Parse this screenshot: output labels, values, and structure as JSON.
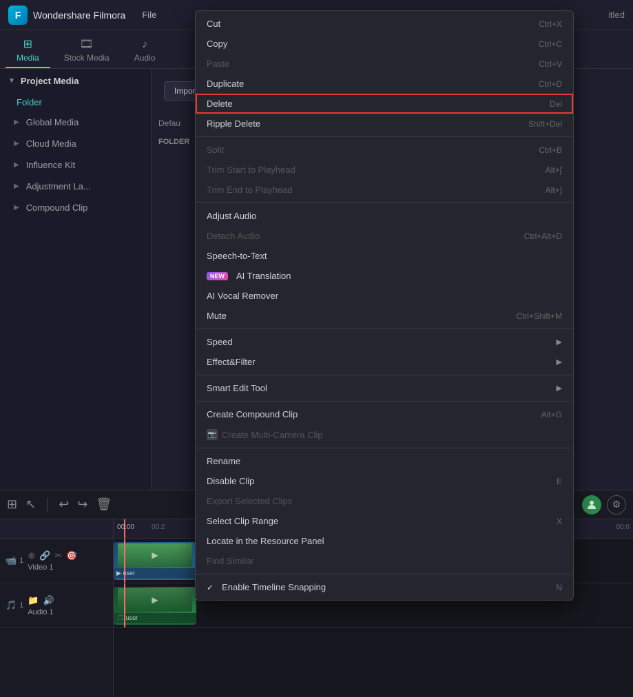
{
  "app": {
    "name": "Wondershare Filmora",
    "logo": "F",
    "title_suffix": "itled"
  },
  "topbar": {
    "menu_items": [
      "File"
    ]
  },
  "media_tabs": [
    {
      "id": "media",
      "label": "Media",
      "icon": "⊞",
      "active": true
    },
    {
      "id": "stock_media",
      "label": "Stock Media",
      "icon": "🎞"
    },
    {
      "id": "audio",
      "label": "Audio",
      "icon": "♪"
    }
  ],
  "sidebar": {
    "header": "Project Media",
    "folder_name": "Folder",
    "items": [
      {
        "label": "Global Media",
        "icon": "▶"
      },
      {
        "label": "Cloud Media",
        "icon": "▶"
      },
      {
        "label": "Influence Kit",
        "icon": "▶"
      },
      {
        "label": "Adjustment La...",
        "icon": "▶"
      },
      {
        "label": "Compound Clip",
        "icon": "▶"
      }
    ],
    "bottom_icons": [
      "📁",
      "📂"
    ]
  },
  "import_area": {
    "import_btn": "Import",
    "default_text": "Defau",
    "folder_label": "FOLDER"
  },
  "timeline": {
    "toolbar_icons": [
      "⊞",
      "↖",
      "|",
      "↩",
      "↪",
      "🗑"
    ],
    "tracks": [
      {
        "name": "Video 1",
        "icons": [
          "📹",
          "🔗",
          "✂",
          "🎯"
        ],
        "clip_label": "user"
      },
      {
        "name": "Audio 1",
        "icons": [
          "🎵",
          "📁",
          "🔊"
        ],
        "clip_label": "user"
      }
    ],
    "ruler": {
      "time1": "00:00",
      "time2": "00:2"
    }
  },
  "context_menu": {
    "items": [
      {
        "label": "Cut",
        "shortcut": "Ctrl+X",
        "enabled": true,
        "highlighted": false
      },
      {
        "label": "Copy",
        "shortcut": "Ctrl+C",
        "enabled": true,
        "highlighted": false
      },
      {
        "label": "Paste",
        "shortcut": "Ctrl+V",
        "enabled": false,
        "highlighted": false
      },
      {
        "label": "Duplicate",
        "shortcut": "Ctrl+D",
        "enabled": true,
        "highlighted": false
      },
      {
        "label": "Delete",
        "shortcut": "Del",
        "enabled": true,
        "highlighted": true
      },
      {
        "label": "Ripple Delete",
        "shortcut": "Shift+Del",
        "enabled": true,
        "highlighted": false
      },
      {
        "separator": true
      },
      {
        "label": "Split",
        "shortcut": "Ctrl+B",
        "enabled": false,
        "highlighted": false
      },
      {
        "label": "Trim Start to Playhead",
        "shortcut": "Alt+[",
        "enabled": false,
        "highlighted": false
      },
      {
        "label": "Trim End to Playhead",
        "shortcut": "Alt+]",
        "enabled": false,
        "highlighted": false
      },
      {
        "separator": true
      },
      {
        "label": "Adjust Audio",
        "shortcut": "",
        "enabled": true,
        "highlighted": false
      },
      {
        "label": "Detach Audio",
        "shortcut": "Ctrl+Alt+D",
        "enabled": false,
        "highlighted": false
      },
      {
        "label": "Speech-to-Text",
        "shortcut": "",
        "enabled": true,
        "highlighted": false
      },
      {
        "label": "AI Translation",
        "shortcut": "",
        "enabled": true,
        "highlighted": false,
        "badge": "NEW"
      },
      {
        "label": "AI Vocal Remover",
        "shortcut": "",
        "enabled": true,
        "highlighted": false
      },
      {
        "label": "Mute",
        "shortcut": "Ctrl+Shift+M",
        "enabled": true,
        "highlighted": false
      },
      {
        "separator": true
      },
      {
        "label": "Speed",
        "shortcut": "",
        "enabled": true,
        "highlighted": false,
        "submenu": true
      },
      {
        "label": "Effect&Filter",
        "shortcut": "",
        "enabled": true,
        "highlighted": false,
        "submenu": true
      },
      {
        "separator": true
      },
      {
        "label": "Smart Edit Tool",
        "shortcut": "",
        "enabled": true,
        "highlighted": false,
        "submenu": true
      },
      {
        "separator": true
      },
      {
        "label": "Create Compound Clip",
        "shortcut": "Alt+G",
        "enabled": true,
        "highlighted": false
      },
      {
        "label": "Create Multi-Camera Clip",
        "shortcut": "",
        "enabled": false,
        "highlighted": false,
        "camera_icon": true
      },
      {
        "separator": true
      },
      {
        "label": "Rename",
        "shortcut": "",
        "enabled": true,
        "highlighted": false
      },
      {
        "label": "Disable Clip",
        "shortcut": "E",
        "enabled": true,
        "highlighted": false
      },
      {
        "label": "Export Selected Clips",
        "shortcut": "",
        "enabled": false,
        "highlighted": false
      },
      {
        "label": "Select Clip Range",
        "shortcut": "X",
        "enabled": true,
        "highlighted": false
      },
      {
        "label": "Locate in the Resource Panel",
        "shortcut": "",
        "enabled": true,
        "highlighted": false
      },
      {
        "label": "Find Similar",
        "shortcut": "",
        "enabled": false,
        "highlighted": false
      },
      {
        "separator": true
      },
      {
        "label": "Enable Timeline Snapping",
        "shortcut": "N",
        "enabled": true,
        "highlighted": false,
        "check": true
      }
    ]
  }
}
